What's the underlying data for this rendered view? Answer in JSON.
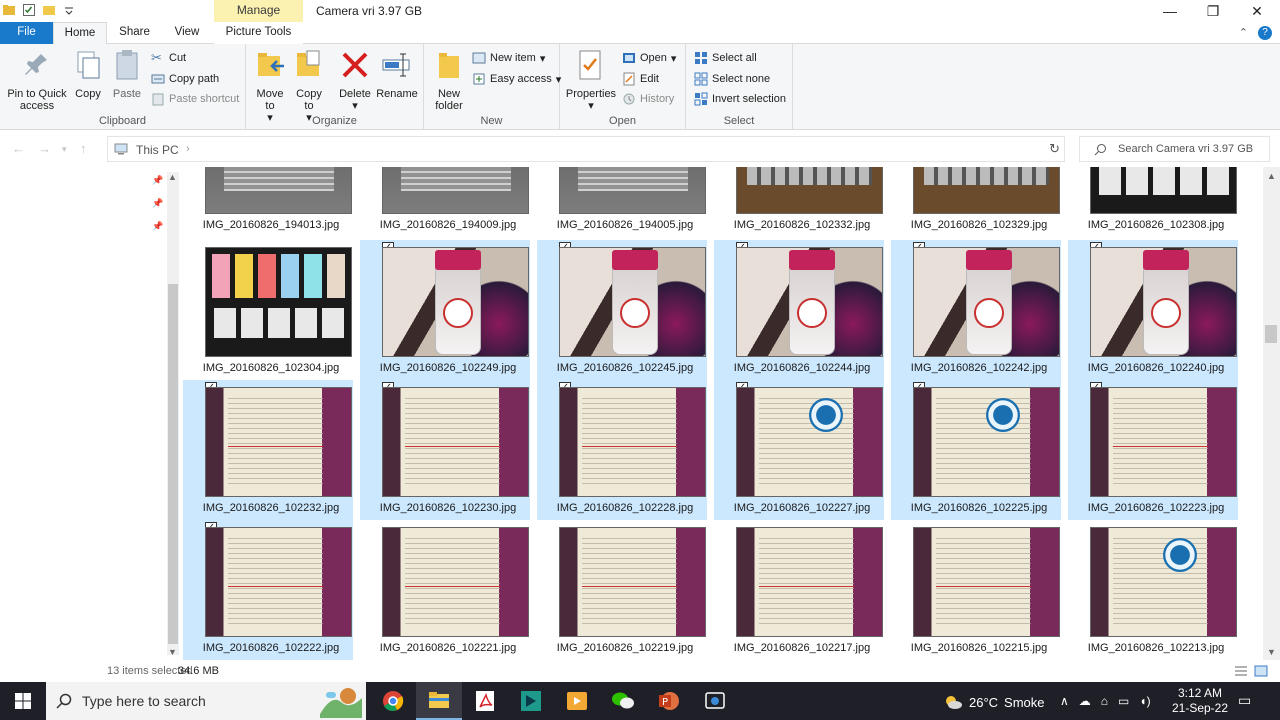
{
  "window": {
    "title": "Camera vri 3.97 GB",
    "contextual_tab_group": "Manage",
    "controls": [
      "—",
      "❐",
      "✕"
    ]
  },
  "ribbon_tabs": [
    "File",
    "Home",
    "Share",
    "View",
    "Picture Tools"
  ],
  "ribbon": {
    "clipboard": {
      "label": "Clipboard",
      "pin": "Pin to Quick access",
      "copy": "Copy",
      "paste": "Paste",
      "cut": "Cut",
      "copy_path": "Copy path",
      "paste_shortcut": "Paste shortcut"
    },
    "organize": {
      "label": "Organize",
      "move_to": "Move to",
      "copy_to": "Copy to",
      "delete": "Delete",
      "rename": "Rename"
    },
    "new": {
      "label": "New",
      "new_folder": "New folder",
      "new_item": "New item",
      "easy_access": "Easy access"
    },
    "open": {
      "label": "Open",
      "properties": "Properties",
      "open": "Open",
      "edit": "Edit",
      "history": "History"
    },
    "select": {
      "label": "Select",
      "select_all": "Select all",
      "select_none": "Select none",
      "invert_selection": "Invert selection"
    }
  },
  "address": {
    "crumb": "This PC",
    "search_placeholder": "Search Camera vri 3.97 GB"
  },
  "files": [
    {
      "name": "IMG_20160826_194013.jpg",
      "kind": "notebook",
      "selected": false
    },
    {
      "name": "IMG_20160826_194009.jpg",
      "kind": "notebook",
      "selected": false
    },
    {
      "name": "IMG_20160826_194005.jpg",
      "kind": "notebook",
      "selected": false
    },
    {
      "name": "IMG_20160826_102332.jpg",
      "kind": "board",
      "selected": false
    },
    {
      "name": "IMG_20160826_102329.jpg",
      "kind": "board",
      "selected": false
    },
    {
      "name": "IMG_20160826_102308.jpg",
      "kind": "cards",
      "selected": false
    },
    {
      "name": "IMG_20160826_102304.jpg",
      "kind": "cards",
      "selected": false
    },
    {
      "name": "IMG_20160826_102249.jpg",
      "kind": "vial",
      "selected": true
    },
    {
      "name": "IMG_20160826_102245.jpg",
      "kind": "vial",
      "selected": true
    },
    {
      "name": "IMG_20160826_102244.jpg",
      "kind": "vial",
      "selected": true
    },
    {
      "name": "IMG_20160826_102242.jpg",
      "kind": "vial",
      "selected": true
    },
    {
      "name": "IMG_20160826_102240.jpg",
      "kind": "vial",
      "selected": true
    },
    {
      "name": "IMG_20160826_102232.jpg",
      "kind": "mug",
      "selected": true
    },
    {
      "name": "IMG_20160826_102230.jpg",
      "kind": "mug",
      "selected": true
    },
    {
      "name": "IMG_20160826_102228.jpg",
      "kind": "mug",
      "selected": true
    },
    {
      "name": "IMG_20160826_102227.jpg",
      "kind": "mugseal",
      "selected": true
    },
    {
      "name": "IMG_20160826_102225.jpg",
      "kind": "mugseal",
      "selected": true
    },
    {
      "name": "IMG_20160826_102223.jpg",
      "kind": "mug",
      "selected": true
    },
    {
      "name": "IMG_20160826_102222.jpg",
      "kind": "mug",
      "selected": true
    },
    {
      "name": "IMG_20160826_102221.jpg",
      "kind": "mug",
      "selected": false
    },
    {
      "name": "IMG_20160826_102219.jpg",
      "kind": "mug",
      "selected": false
    },
    {
      "name": "IMG_20160826_102217.jpg",
      "kind": "mug",
      "selected": false
    },
    {
      "name": "IMG_20160826_102215.jpg",
      "kind": "mug",
      "selected": false
    },
    {
      "name": "IMG_20160826_102213.jpg",
      "kind": "mugseal",
      "selected": false
    }
  ],
  "status": {
    "selected_text": "13 items selected",
    "size": "34.6 MB"
  },
  "taskbar": {
    "search_placeholder": "Type here to search",
    "weather_temp": "26°C",
    "weather_desc": "Smoke",
    "time": "3:12 AM",
    "date": "21-Sep-22"
  },
  "colors": {
    "file_tab": "#1979ca",
    "selection": "#cce8ff",
    "manage_tab": "#fbf2b1",
    "taskbar": "#1f1f27"
  }
}
